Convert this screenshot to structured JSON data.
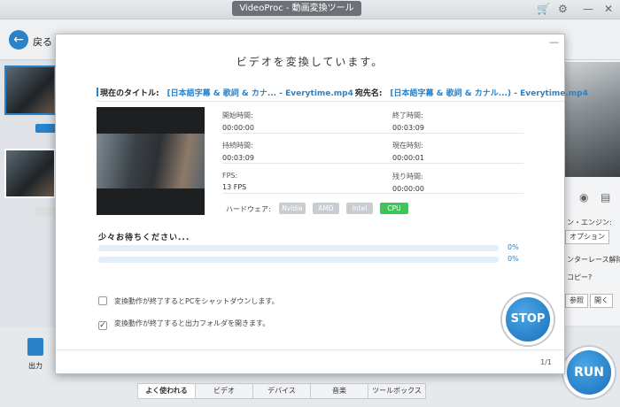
{
  "window": {
    "title": "VideoProc - 動画変換ツール"
  },
  "toolbar": {
    "back_label": "戻る"
  },
  "right_panel": {
    "engine_label": "ン・エンジン:",
    "option_button": "オプション",
    "interlace_label": "ンターレース解除",
    "copy_label": "コピー?",
    "browse_button": "参照",
    "open_button": "開く"
  },
  "dialog": {
    "title": "ビデオを変換しています。",
    "current_title_label": "現在のタイトル:",
    "current_title_value": "[日本語字幕 & 歌詞 & カナ... - Everytime.mp4",
    "destination_label": "宛先名:",
    "destination_value": "[日本語字幕 & 歌詞 & カナル...) - Everytime.mp4",
    "info": {
      "start_time_label": "開始時間:",
      "start_time": "00:00:00",
      "end_time_label": "終了時間:",
      "end_time": "00:03:09",
      "duration_label": "持続時間:",
      "duration": "00:03:09",
      "current_time_label": "現在時刻:",
      "current_time": "00:00:01",
      "fps_label": "FPS:",
      "fps": "13 FPS",
      "remaining_label": "残り時間:",
      "remaining": "00:00:00"
    },
    "hardware_label": "ハードウェア:",
    "hardware": [
      {
        "name": "Nvidia",
        "active": false
      },
      {
        "name": "AMD",
        "active": false
      },
      {
        "name": "Intel",
        "active": false
      },
      {
        "name": "CPU",
        "active": true
      }
    ],
    "wait_text": "少々お待ちください...",
    "progress": [
      {
        "value": 0,
        "label": "0%"
      },
      {
        "value": 0,
        "label": "0%"
      }
    ],
    "options": [
      {
        "text": "変換動作が終了するとPCをシャットダウンします。",
        "checked": false
      },
      {
        "text": "変換動作が終了すると出力フォルダを開きます。",
        "checked": true
      }
    ],
    "stop_label": "STOP",
    "page_count": "1/1"
  },
  "bottom": {
    "output_label": "出力",
    "tabs": [
      "よく使われる",
      "ビデオ",
      "デバイス",
      "音楽",
      "ツールボックス"
    ],
    "run_label": "RUN"
  },
  "colors": {
    "accent": "#2a82c8",
    "cpu_active": "#3fc45a"
  }
}
